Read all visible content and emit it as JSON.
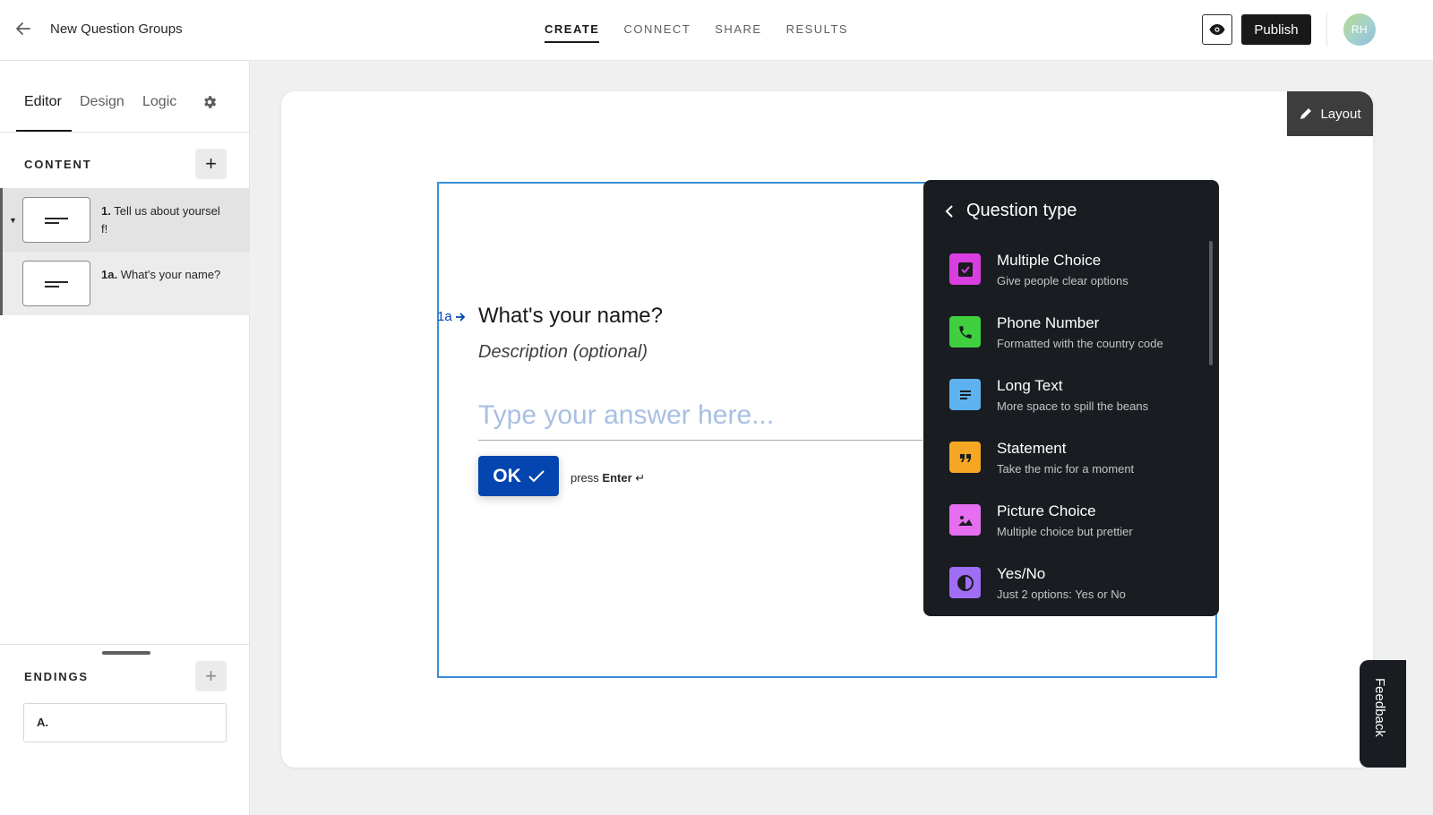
{
  "header": {
    "form_title": "New Question Groups",
    "tabs": [
      {
        "label": "CREATE",
        "active": true
      },
      {
        "label": "CONNECT",
        "active": false
      },
      {
        "label": "SHARE",
        "active": false
      },
      {
        "label": "RESULTS",
        "active": false
      }
    ],
    "publish_label": "Publish",
    "avatar_initials": "RH"
  },
  "sidebar": {
    "tabs": [
      {
        "label": "Editor",
        "active": true
      },
      {
        "label": "Design",
        "active": false
      },
      {
        "label": "Logic",
        "active": false
      }
    ],
    "content_label": "CONTENT",
    "add_label": "+",
    "questions": [
      {
        "num": "1.",
        "text": "Tell us about yourself!"
      },
      {
        "num": "1a.",
        "text": "What's your name?"
      }
    ],
    "endings_label": "ENDINGS",
    "endings_add_label": "+",
    "ending_item": "A."
  },
  "canvas": {
    "layout_label": "Layout",
    "question_number": "1a",
    "question_title": "What's your name?",
    "description_placeholder": "Description (optional)",
    "answer_placeholder": "Type your answer here...",
    "ok_label": "OK",
    "press_label": "press",
    "enter_label": "Enter"
  },
  "question_type_panel": {
    "title": "Question type",
    "items": [
      {
        "name": "Multiple Choice",
        "desc": "Give people clear options",
        "color": "#d93ee0",
        "icon": "checkbox-icon"
      },
      {
        "name": "Phone Number",
        "desc": "Formatted with the country code",
        "color": "#3fcf3f",
        "icon": "phone-icon"
      },
      {
        "name": "Long Text",
        "desc": "More space to spill the beans",
        "color": "#5fb2f0",
        "icon": "lines-icon"
      },
      {
        "name": "Statement",
        "desc": "Take the mic for a moment",
        "color": "#f5a623",
        "icon": "quote-icon"
      },
      {
        "name": "Picture Choice",
        "desc": "Multiple choice but prettier",
        "color": "#e66ef0",
        "icon": "image-icon"
      },
      {
        "name": "Yes/No",
        "desc": "Just 2 options: Yes or No",
        "color": "#a06ef5",
        "icon": "contrast-icon"
      }
    ]
  },
  "feedback_label": "Feedback",
  "colors": {
    "accent_blue": "#0445af",
    "frame_blue": "#3a8fd9",
    "dark_panel": "#191c21"
  }
}
